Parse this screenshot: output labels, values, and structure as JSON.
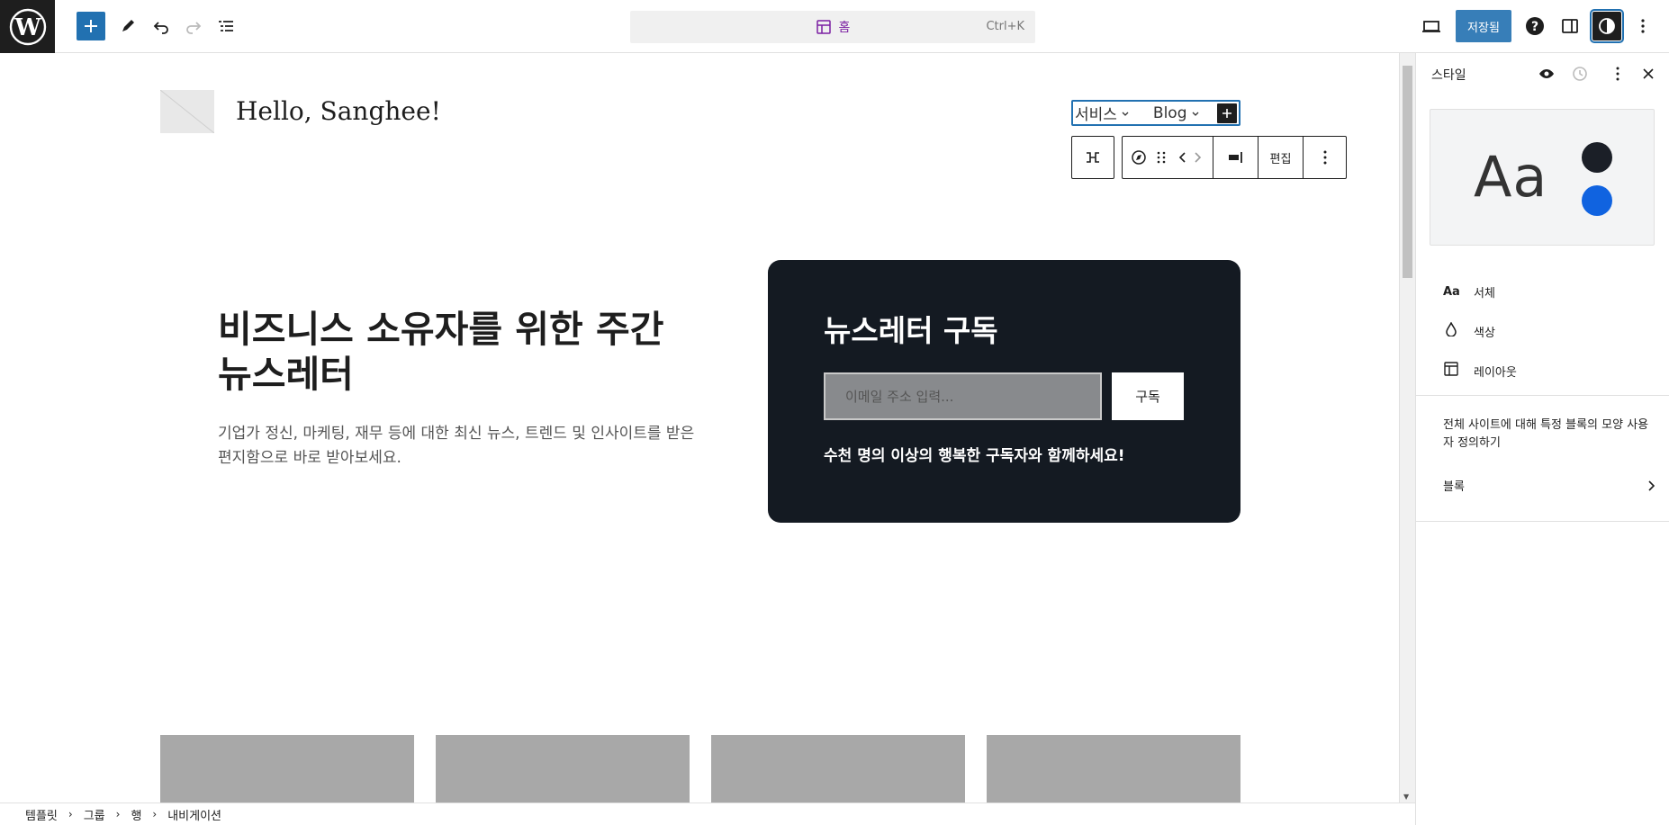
{
  "topbar": {
    "search_title": "홈",
    "search_shortcut": "Ctrl+K",
    "save_label": "저장됨"
  },
  "canvas": {
    "site_title": "Hello, Sanghee!",
    "nav": {
      "items": [
        "서비스",
        "Blog"
      ]
    },
    "block_toolbar": {
      "edit_label": "편집"
    },
    "hero": {
      "heading": "비즈니스 소유자를 위한 주간 뉴스레터",
      "description": "기업가 정신, 마케팅, 재무 등에 대한 최신 뉴스, 트렌드 및 인사이트를 받은 편지함으로 바로 받아보세요."
    },
    "newsletter": {
      "title": "뉴스레터 구독",
      "input_placeholder": "이메일 주소 입력...",
      "button_label": "구독",
      "note": "수천 명의 이상의 행복한 구독자와 함께하세요!"
    }
  },
  "breadcrumb": [
    "템플릿",
    "그룹",
    "행",
    "내비게이션"
  ],
  "sidebar": {
    "title": "스타일",
    "preview_text": "Aa",
    "colors": {
      "primary_dot": "#1b1f27",
      "secondary_dot": "#1063e0"
    },
    "items": [
      {
        "icon": "Aa",
        "label": "서체"
      },
      {
        "icon": "droplet",
        "label": "색상"
      },
      {
        "icon": "layout",
        "label": "레이아웃"
      }
    ],
    "description": "전체 사이트에 대해 특정 블록의 모양 사용자 정의하기",
    "blocks_label": "블록"
  }
}
